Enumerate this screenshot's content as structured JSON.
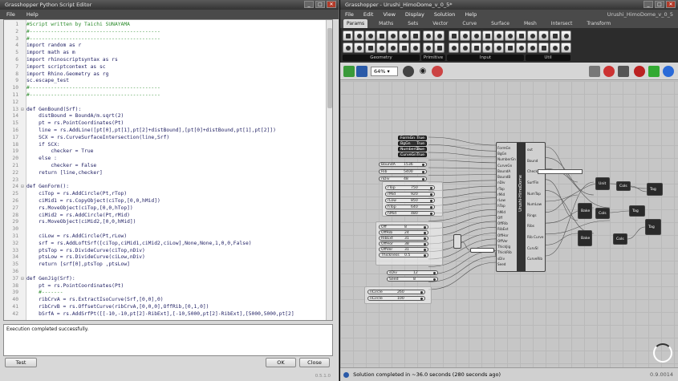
{
  "editor": {
    "title": "Grasshopper Python Script Editor",
    "menu": [
      "File",
      "Help"
    ],
    "code_lines": [
      {
        "n": "1",
        "text": "#Script written by Taichi SUNAYAMA",
        "style": "comment"
      },
      {
        "n": "2",
        "text": "#-------------------------------------------",
        "style": "comment"
      },
      {
        "n": "3",
        "text": "#-------------------------------------------",
        "style": "comment"
      },
      {
        "n": "4",
        "text": "import random as r",
        "style": "code"
      },
      {
        "n": "5",
        "text": "import math as m",
        "style": "code"
      },
      {
        "n": "6",
        "text": "import rhinoscriptsyntax as rs",
        "style": "code"
      },
      {
        "n": "7",
        "text": "import scriptcontext as sc",
        "style": "code"
      },
      {
        "n": "8",
        "text": "import Rhino.Geometry as rg",
        "style": "code"
      },
      {
        "n": "9",
        "text": "sc.escape_test",
        "style": "code"
      },
      {
        "n": "10",
        "text": "#-------------------------------------------",
        "style": "comment"
      },
      {
        "n": "11",
        "text": "#-------------------------------------------",
        "style": "comment"
      },
      {
        "n": "12",
        "text": "",
        "style": "code"
      },
      {
        "n": "13",
        "text": "def GenBound(Srf):",
        "style": "code"
      },
      {
        "n": "14",
        "text": "    distBound = BoundA/m.sqrt(2)",
        "style": "code"
      },
      {
        "n": "15",
        "text": "    pt = rs.PointCoordinates(Pt)",
        "style": "code"
      },
      {
        "n": "16",
        "text": "    line = rs.AddLine([pt[0],pt[1],pt[2]+distBound],[pt[0]+distBound,pt[1],pt[2]])",
        "style": "code"
      },
      {
        "n": "17",
        "text": "    SCX = rs.CurveSurfaceIntersection(line,Srf)",
        "style": "code"
      },
      {
        "n": "18",
        "text": "    if SCX:",
        "style": "code"
      },
      {
        "n": "19",
        "text": "        checker = True",
        "style": "code"
      },
      {
        "n": "20",
        "text": "    else :",
        "style": "code"
      },
      {
        "n": "21",
        "text": "        checker = False",
        "style": "code"
      },
      {
        "n": "22",
        "text": "    return [line,checker]",
        "style": "code"
      },
      {
        "n": "23",
        "text": "",
        "style": "code"
      },
      {
        "n": "24",
        "text": "def GenForm():",
        "style": "code"
      },
      {
        "n": "25",
        "text": "    ciTop = rs.AddCircle(Pt,rTop)",
        "style": "code"
      },
      {
        "n": "26",
        "text": "    ciMid1 = rs.CopyObject(ciTop,[0,0,hMid])",
        "style": "code"
      },
      {
        "n": "27",
        "text": "    rs.MoveObject(ciTop,[0,0,hTop])",
        "style": "code"
      },
      {
        "n": "28",
        "text": "    ciMid2 = rs.AddCircle(Pt,rMid)",
        "style": "code"
      },
      {
        "n": "29",
        "text": "    rs.MoveObject(ciMid2,[0,0,hMid])",
        "style": "code"
      },
      {
        "n": "30",
        "text": "",
        "style": "code"
      },
      {
        "n": "31",
        "text": "    ciLow = rs.AddCircle(Pt,rLow)",
        "style": "code"
      },
      {
        "n": "32",
        "text": "    srf = rs.AddLoftSrf([ciTop,ciMid1,ciMid2,ciLow],None,None,1,0,0,False)",
        "style": "code"
      },
      {
        "n": "33",
        "text": "    ptsTop = rs.DivideCurve(ciTop,nDiv)",
        "style": "code"
      },
      {
        "n": "34",
        "text": "    ptsLow = rs.DivideCurve(ciLow,nDiv)",
        "style": "code"
      },
      {
        "n": "35",
        "text": "    return [srf[0],ptsTop ,ptsLow]",
        "style": "code"
      },
      {
        "n": "36",
        "text": "",
        "style": "code"
      },
      {
        "n": "37",
        "text": "def GenJig(Srf):",
        "style": "code"
      },
      {
        "n": "38",
        "text": "    pt = rs.PointCoordinates(Pt)",
        "style": "code"
      },
      {
        "n": "39",
        "text": "    #-------",
        "style": "comment"
      },
      {
        "n": "40",
        "text": "    ribCrvA = rs.ExtractIsoCurve(Srf,[0,0],0)",
        "style": "code"
      },
      {
        "n": "41",
        "text": "    ribCrvB = rs.OffsetCurve(ribCrvA,[0,0,0],OffRib,[0,1,0])",
        "style": "code"
      },
      {
        "n": "42",
        "text": "    bSrfA = rs.AddSrfPt([[-10,-10,pt[2]-RibExt],[-10,5000,pt[2]-RibExt],[5000,5000,pt[2]",
        "style": "code"
      }
    ],
    "output_text": "Execution completed successfully.",
    "buttons": {
      "test": "Test",
      "ok": "OK",
      "close": "Close"
    },
    "version": "0.5.1.0"
  },
  "gh": {
    "title": "Grasshopper - Urushi_HimoDome_v_0_5*",
    "doc_label": "Urushi_HimoDome_v_0_5",
    "menu": [
      "File",
      "Edit",
      "View",
      "Display",
      "Solution",
      "Help"
    ],
    "tabs": [
      "Params",
      "Maths",
      "Sets",
      "Vector",
      "Curve",
      "Surface",
      "Mesh",
      "Intersect",
      "Transform"
    ],
    "ribbon_groups": [
      "Geometry",
      "Primitive",
      "Input",
      "Util"
    ],
    "zoom": "64%",
    "status": "Solution completed in ~36.0 seconds (280 seconds ago)",
    "version": "0.9.0014",
    "python_component": {
      "title": "Urushi-HimoDome",
      "inputs": [
        "FormGn",
        "BgGn",
        "NumberGn",
        "CurveGn",
        "BoundA",
        "BoundB",
        "nDiv",
        "rTop",
        "rMid",
        "rLow",
        "hTop",
        "hMid",
        "Off",
        "OffRib",
        "RibExt",
        "OffHor",
        "OffVer",
        "ThickJig",
        "ThickRib",
        "sDiv",
        "Seed"
      ],
      "outputs": [
        "out",
        "Bound",
        "Checker",
        "SurfFin",
        "NumTop",
        "NumLow",
        "Rings",
        "Ribs",
        "Rib Curve",
        "CurvSI",
        "CurveRib"
      ]
    },
    "toggles": [
      "FormGn",
      "BgGn",
      "NumberGn",
      "CurveGn"
    ],
    "toggle_value": "True",
    "sliders": [
      {
        "name": "BoundA",
        "value": "1536"
      },
      {
        "name": "Rib",
        "value": "5400"
      },
      {
        "name": "nDiv",
        "value": "48"
      },
      {
        "name": "rTop",
        "value": "750"
      },
      {
        "name": "rMid",
        "value": "920"
      },
      {
        "name": "rLow",
        "value": "850"
      },
      {
        "name": "hTop",
        "value": "640"
      },
      {
        "name": "hMid",
        "value": "480"
      },
      {
        "name": "Off",
        "value": "8"
      },
      {
        "name": "OffRib",
        "value": "24"
      },
      {
        "name": "RibExt",
        "value": "31"
      },
      {
        "name": "OffHor",
        "value": "38"
      },
      {
        "name": "OffVer",
        "value": "31"
      },
      {
        "name": "Thickness",
        "value": "0.5"
      },
      {
        "name": "sDiv",
        "value": "12"
      },
      {
        "name": "Seed",
        "value": "8"
      },
      {
        "name": "nCircle",
        "value": "260"
      },
      {
        "name": "nCircle",
        "value": "100"
      }
    ],
    "right_components": [
      "Unit",
      "Cols",
      "Bake",
      "Cols",
      "Bake",
      "Cols"
    ],
    "tag_labels": [
      "Tag",
      "Tag",
      "Tag"
    ]
  }
}
